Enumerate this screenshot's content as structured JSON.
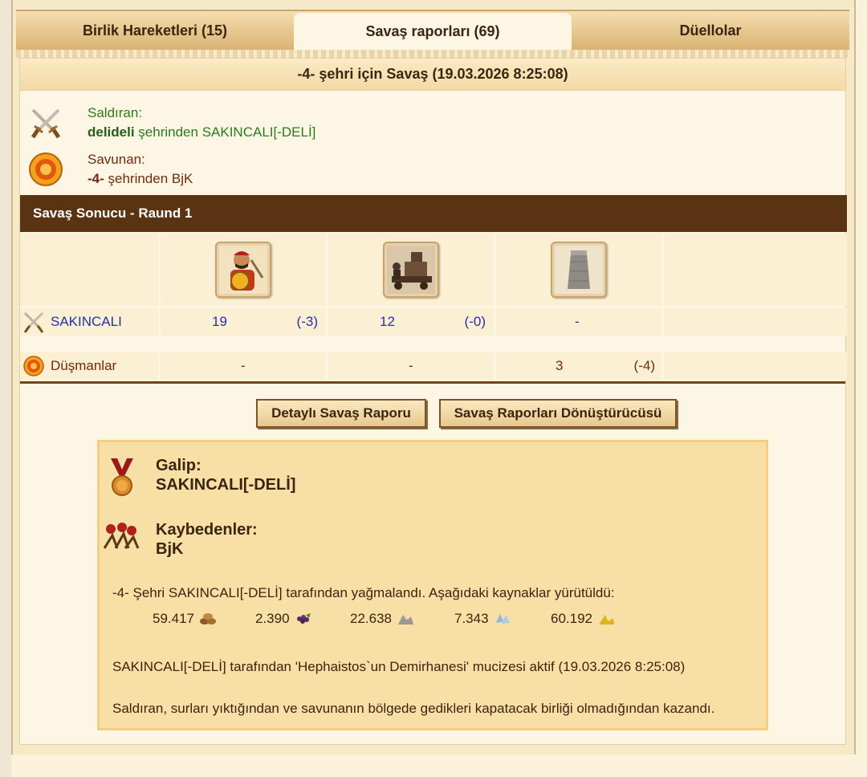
{
  "tabs": [
    {
      "label": "Birlik Hareketleri (15)",
      "active": false
    },
    {
      "label": "Savaş raporları (69)",
      "active": true
    },
    {
      "label": "Düellolar",
      "active": false
    }
  ],
  "report": {
    "title": "-4- şehri için Savaş (19.03.2026 8:25:08)",
    "attacker": {
      "label": "Saldıran:",
      "city": "delideli",
      "rest": " şehrinden SAKINCALI[-DELİ]",
      "icon": "crossed-swords-icon"
    },
    "defender": {
      "label": "Savunan:",
      "city": "-4-",
      "rest": " şehrinden BjK",
      "icon": "shield-icon"
    }
  },
  "battle": {
    "header": "Savaş Sonucu - Raund 1",
    "units": [
      "hoplite-unit-icon",
      "catapult-unit-icon",
      "wall-unit-icon"
    ],
    "attacker_row": {
      "name": "SAKINCALI",
      "u1": "19",
      "u1_loss": "(-3)",
      "u2": "12",
      "u2_loss": "(-0)",
      "u3": "-"
    },
    "defender_row": {
      "name": "Düşmanlar",
      "u1": "-",
      "u2": "-",
      "u3": "3",
      "u3_loss": "(-4)"
    }
  },
  "buttons": {
    "detailed": "Detaylı Savaş Raporu",
    "converter": "Savaş Raporları Dönüştürücüsü"
  },
  "summary": {
    "winner_label": "Galip:",
    "winner": "SAKINCALI[-DELİ]",
    "losers_label": "Kaybedenler:",
    "loser": "BjK",
    "plunder_text": "-4- Şehri SAKINCALI[-DELİ] tarafından yağmalandı. Aşağıdaki kaynaklar yürütüldü:",
    "resources": [
      {
        "value": "59.417",
        "icon": "wood-icon"
      },
      {
        "value": "2.390",
        "icon": "wine-icon"
      },
      {
        "value": "22.638",
        "icon": "marble-icon"
      },
      {
        "value": "7.343",
        "icon": "crystal-icon"
      },
      {
        "value": "60.192",
        "icon": "sulfur-icon"
      }
    ],
    "wonder_text": "SAKINCALI[-DELİ] tarafından 'Hephaistos`un Demirhanesi' mucizesi aktif (19.03.2026 8:25:08)",
    "reason_text": "Saldıran, surları yıktığından ve savunanın bölgede gedikleri kapatacak birliği olmadığından kazandı."
  },
  "colors": {
    "attacker_green": "#2c7a1a",
    "defender_brown": "#6e2b0e",
    "header_bar": "#5a3312",
    "ally_blue": "#2530a8"
  }
}
